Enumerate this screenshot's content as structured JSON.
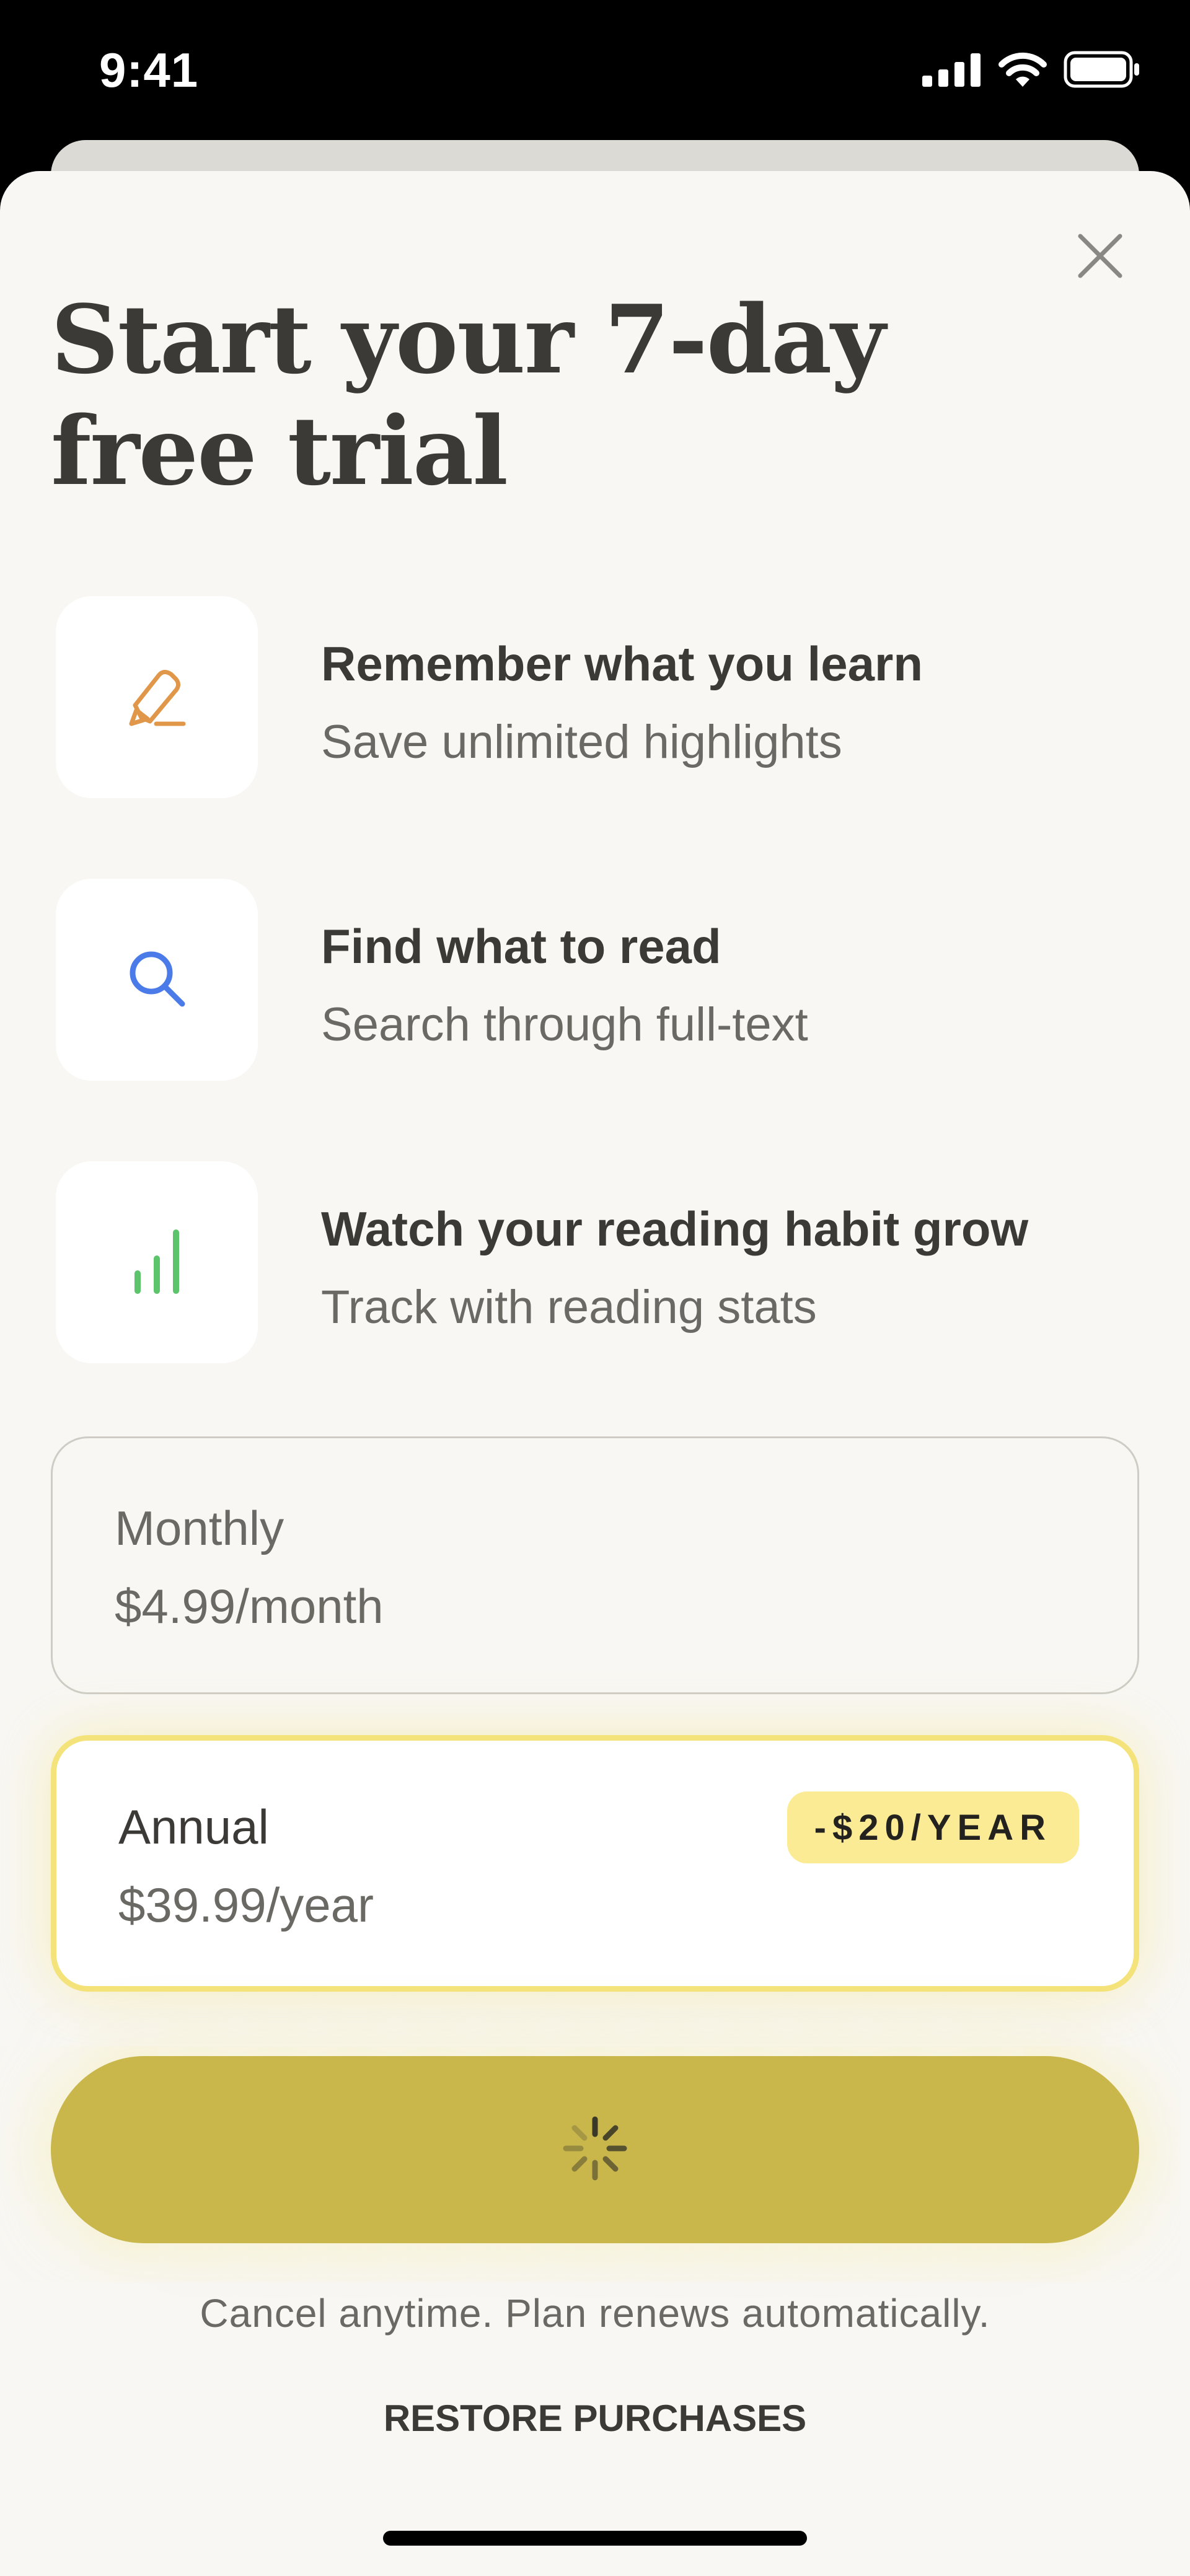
{
  "status_bar": {
    "time": "9:41",
    "signal_icon": "cellular-signal-icon",
    "wifi_icon": "wifi-icon",
    "battery_icon": "battery-icon"
  },
  "sheet": {
    "close_icon": "close-icon",
    "title_line1": "Start your 7-day",
    "title_line2": "free trial"
  },
  "features": [
    {
      "icon": "highlighter-icon",
      "icon_color": "#e0974a",
      "title": "Remember what you learn",
      "subtitle": "Save unlimited highlights"
    },
    {
      "icon": "search-icon",
      "icon_color": "#4a7be8",
      "title": "Find what to read",
      "subtitle": "Search through full-text"
    },
    {
      "icon": "bar-chart-icon",
      "icon_color": "#5cc46a",
      "title": "Watch your reading habit grow",
      "subtitle": "Track with reading stats"
    }
  ],
  "plans": {
    "monthly": {
      "name": "Monthly",
      "price": "$4.99/month",
      "selected": false
    },
    "annual": {
      "name": "Annual",
      "price": "$39.99/year",
      "badge": "-$20/YEAR",
      "selected": true
    }
  },
  "cta": {
    "state": "loading",
    "spinner_icon": "loading-spinner-icon",
    "color": "#c9b74c"
  },
  "footer": {
    "note": "Cancel anytime. Plan renews automatically.",
    "restore_label": "RESTORE PURCHASES"
  },
  "colors": {
    "accent_yellow": "#f4e37a",
    "badge_bg": "#faeb94",
    "sheet_bg": "#f8f7f3",
    "text_dark": "#3c3a37",
    "text_muted": "#6b6964"
  }
}
